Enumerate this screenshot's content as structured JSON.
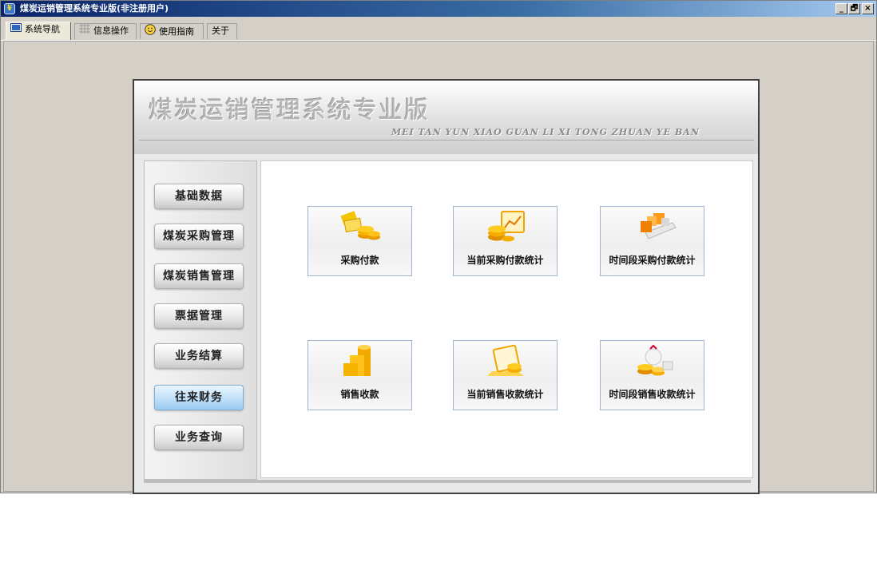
{
  "window": {
    "title": "煤炭运销管理系统专业版(非注册用户)",
    "controls": [
      "_",
      "🗗",
      "×"
    ]
  },
  "tabs": [
    {
      "label": "系统导航",
      "icon": "monitor-icon",
      "active": true
    },
    {
      "label": "信息操作",
      "icon": "grid-icon",
      "active": false
    },
    {
      "label": "使用指南",
      "icon": "smiley-icon",
      "active": false
    },
    {
      "label": "关于",
      "icon": "",
      "active": false
    }
  ],
  "banner": {
    "title": "煤炭运销管理系统专业版",
    "subtitle": "MEI TAN YUN XIAO GUAN LI XI TONG ZHUAN YE BAN"
  },
  "sidebar": {
    "items": [
      {
        "label": "基础数据"
      },
      {
        "label": "煤炭采购管理"
      },
      {
        "label": "煤炭销售管理"
      },
      {
        "label": "票据管理"
      },
      {
        "label": "业务结算"
      },
      {
        "label": "往来财务",
        "active": true
      },
      {
        "label": "业务查询"
      }
    ]
  },
  "functions": [
    {
      "label": "采购付款",
      "icon": "coins-cards-icon"
    },
    {
      "label": "当前采购付款统计",
      "icon": "coins-monitor-icon"
    },
    {
      "label": "时间段采购付款统计",
      "icon": "coins-boxes-icon"
    },
    {
      "label": "销售收款",
      "icon": "coin-stack-icon"
    },
    {
      "label": "当前销售收款统计",
      "icon": "coin-laptop-icon"
    },
    {
      "label": "时间段销售收款统计",
      "icon": "money-bag-icon"
    }
  ],
  "colors": {
    "titlebar_start": "#0a246a",
    "titlebar_end": "#a6caf0",
    "active_nav": "#bfe0f8",
    "gold": "#f2a900"
  }
}
